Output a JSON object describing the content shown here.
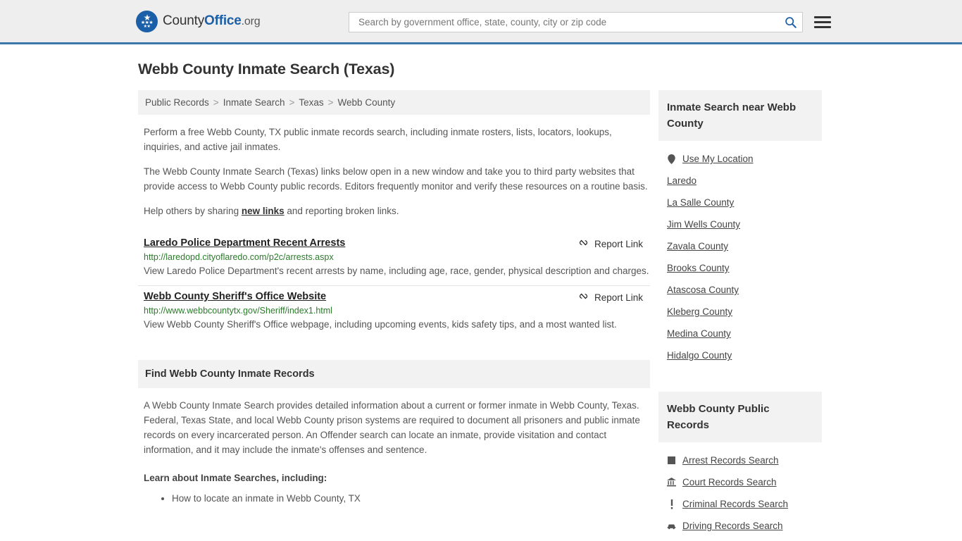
{
  "header": {
    "logo": {
      "text_1": "County",
      "text_2": "Office",
      "text_3": ".org",
      "icon": "eagle-stars-emblem"
    },
    "search": {
      "placeholder": "Search by government office, state, county, city or zip code",
      "value": "",
      "icon": "search-icon"
    },
    "menu_icon": "hamburger-menu-icon",
    "accent_color": "#3b77a8",
    "background": "#eeeeee"
  },
  "page": {
    "title": "Webb County Inmate Search (Texas)"
  },
  "breadcrumb": {
    "items": [
      "Public Records",
      "Inmate Search",
      "Texas",
      "Webb County"
    ],
    "separator": ">"
  },
  "intro": {
    "p1": "Perform a free Webb County, TX public inmate records search, including inmate rosters, lists, locators, lookups, inquiries, and active jail inmates.",
    "p2": "The Webb County Inmate Search (Texas) links below open in a new window and take you to third party websites that provide access to Webb County public records. Editors frequently monitor and verify these resources on a routine basis.",
    "p3_before": "Help others by sharing ",
    "p3_link": "new links",
    "p3_after": " and reporting broken links."
  },
  "links": [
    {
      "title": "Laredo Police Department Recent Arrests",
      "url": "http://laredopd.cityoflaredo.com/p2c/arrests.aspx",
      "description": "View Laredo Police Department's recent arrests by name, including age, race, gender, physical description and charges.",
      "report_label": "Report Link",
      "report_icon": "broken-link-icon"
    },
    {
      "title": "Webb County Sheriff's Office Website",
      "url": "http://www.webbcountytx.gov/Sheriff/index1.html",
      "description": "View Webb County Sheriff's Office webpage, including upcoming events, kids safety tips, and a most wanted list.",
      "report_label": "Report Link",
      "report_icon": "broken-link-icon"
    }
  ],
  "find_section": {
    "heading": "Find Webb County Inmate Records",
    "paragraph": "A Webb County Inmate Search provides detailed information about a current or former inmate in Webb County, Texas. Federal, Texas State, and local Webb County prison systems are required to document all prisoners and public inmate records on every incarcerated person. An Offender search can locate an inmate, provide visitation and contact information, and it may include the inmate's offenses and sentence.",
    "learn_label": "Learn about Inmate Searches, including:",
    "bullets": [
      "How to locate an inmate in Webb County, TX"
    ]
  },
  "sidebar": {
    "near_panel": {
      "heading": "Inmate Search near Webb County",
      "items": [
        {
          "label": "Use My Location",
          "icon": "location-pin-icon"
        },
        {
          "label": "Laredo",
          "icon": ""
        },
        {
          "label": "La Salle County",
          "icon": ""
        },
        {
          "label": "Jim Wells County",
          "icon": ""
        },
        {
          "label": "Zavala County",
          "icon": ""
        },
        {
          "label": "Brooks County",
          "icon": ""
        },
        {
          "label": "Atascosa County",
          "icon": ""
        },
        {
          "label": "Kleberg County",
          "icon": ""
        },
        {
          "label": "Medina County",
          "icon": ""
        },
        {
          "label": "Hidalgo County",
          "icon": ""
        }
      ]
    },
    "records_panel": {
      "heading": "Webb County Public Records",
      "items": [
        {
          "label": "Arrest Records Search",
          "icon": "square-icon",
          "glyph": "■"
        },
        {
          "label": "Court Records Search",
          "icon": "courthouse-icon",
          "glyph": "🏛"
        },
        {
          "label": "Criminal Records Search",
          "icon": "exclamation-icon",
          "glyph": "!"
        },
        {
          "label": "Driving Records Search",
          "icon": "car-icon",
          "glyph": "🚗"
        }
      ]
    }
  }
}
